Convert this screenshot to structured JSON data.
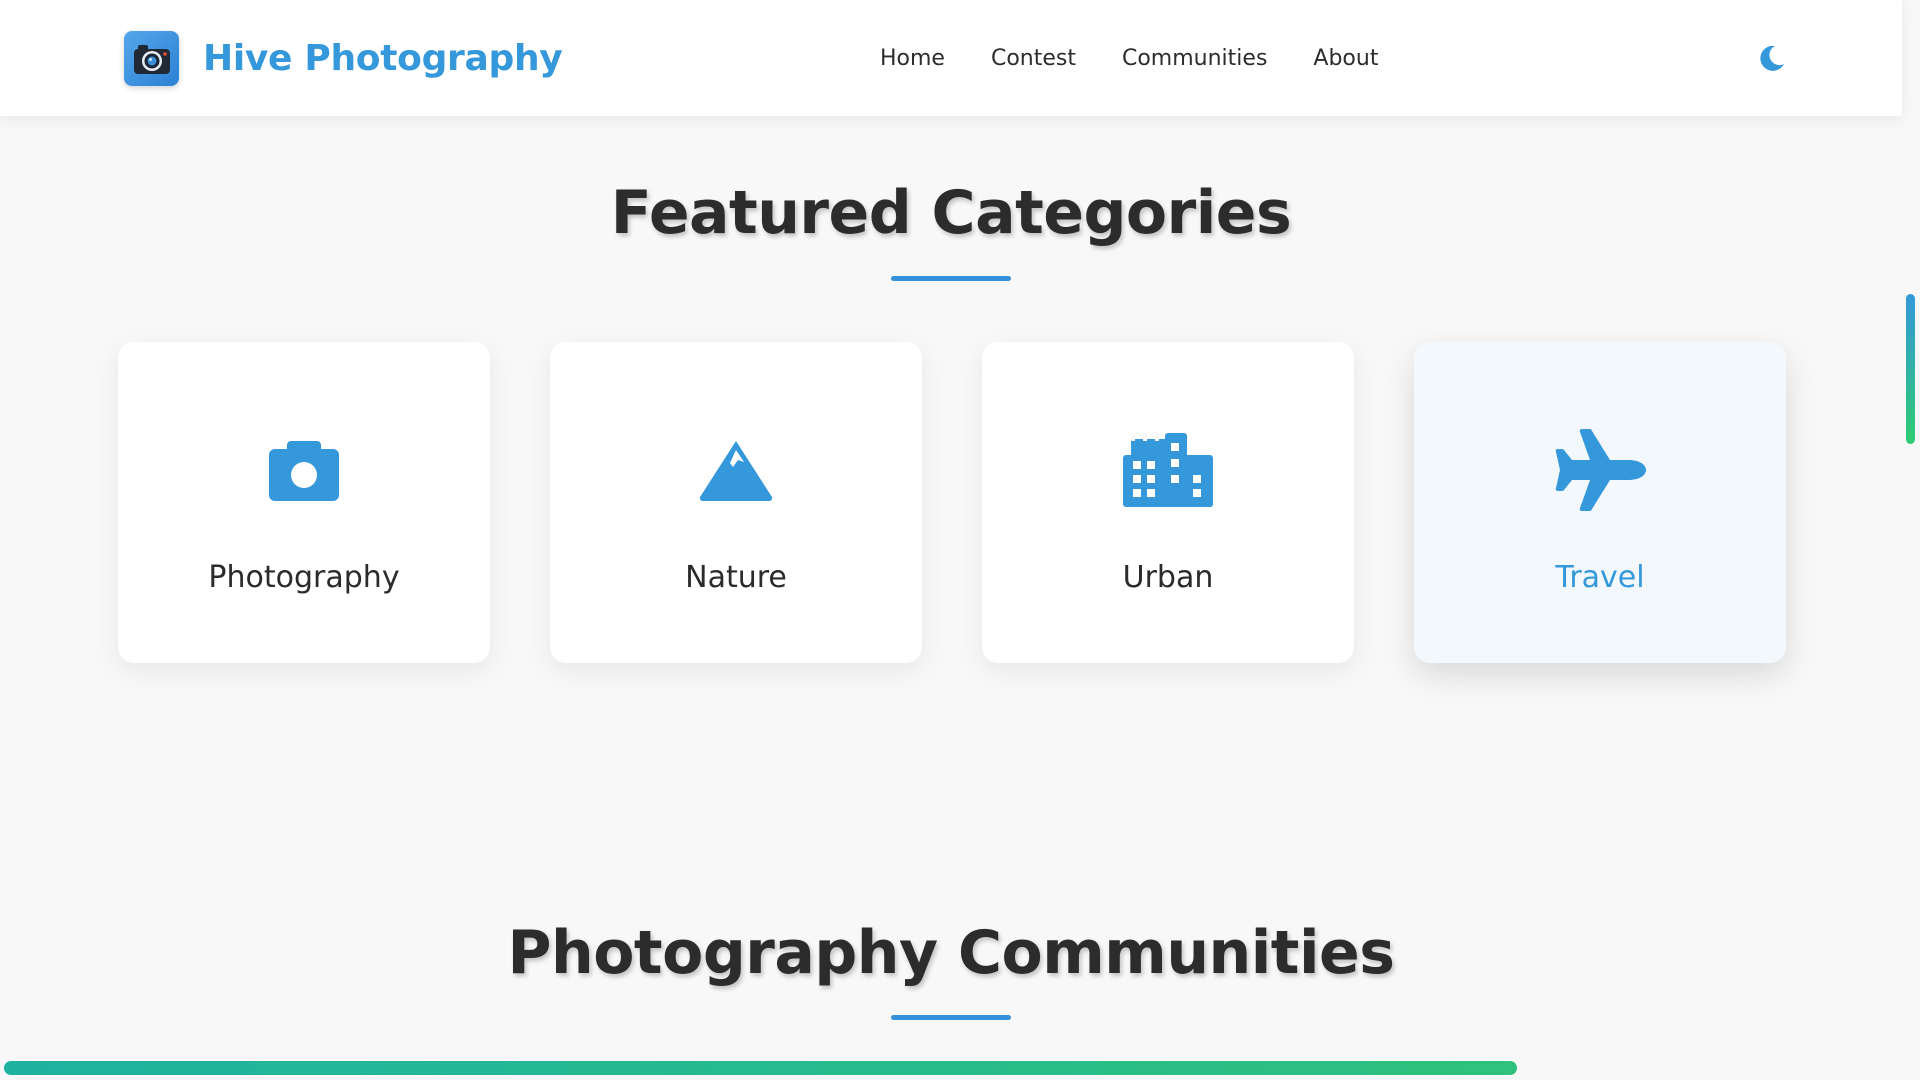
{
  "header": {
    "brand": "Hive Photography",
    "nav": [
      "Home",
      "Contest",
      "Communities",
      "About"
    ]
  },
  "featured": {
    "title": "Featured Categories",
    "cards": [
      {
        "label": "Photography",
        "icon": "camera-icon"
      },
      {
        "label": "Nature",
        "icon": "mountain-icon"
      },
      {
        "label": "Urban",
        "icon": "city-icon"
      },
      {
        "label": "Travel",
        "icon": "plane-icon",
        "state": "hover"
      }
    ]
  },
  "communities": {
    "title": "Photography Communities"
  },
  "colors": {
    "accent": "#3498db",
    "heading": "#2c2c2c",
    "background": "#f8f8f8",
    "progress_start": "#1fb2a0",
    "progress_end": "#2ec27e"
  },
  "icons": {
    "logo": "camera-logo-icon",
    "theme_toggle": "moon-icon"
  }
}
